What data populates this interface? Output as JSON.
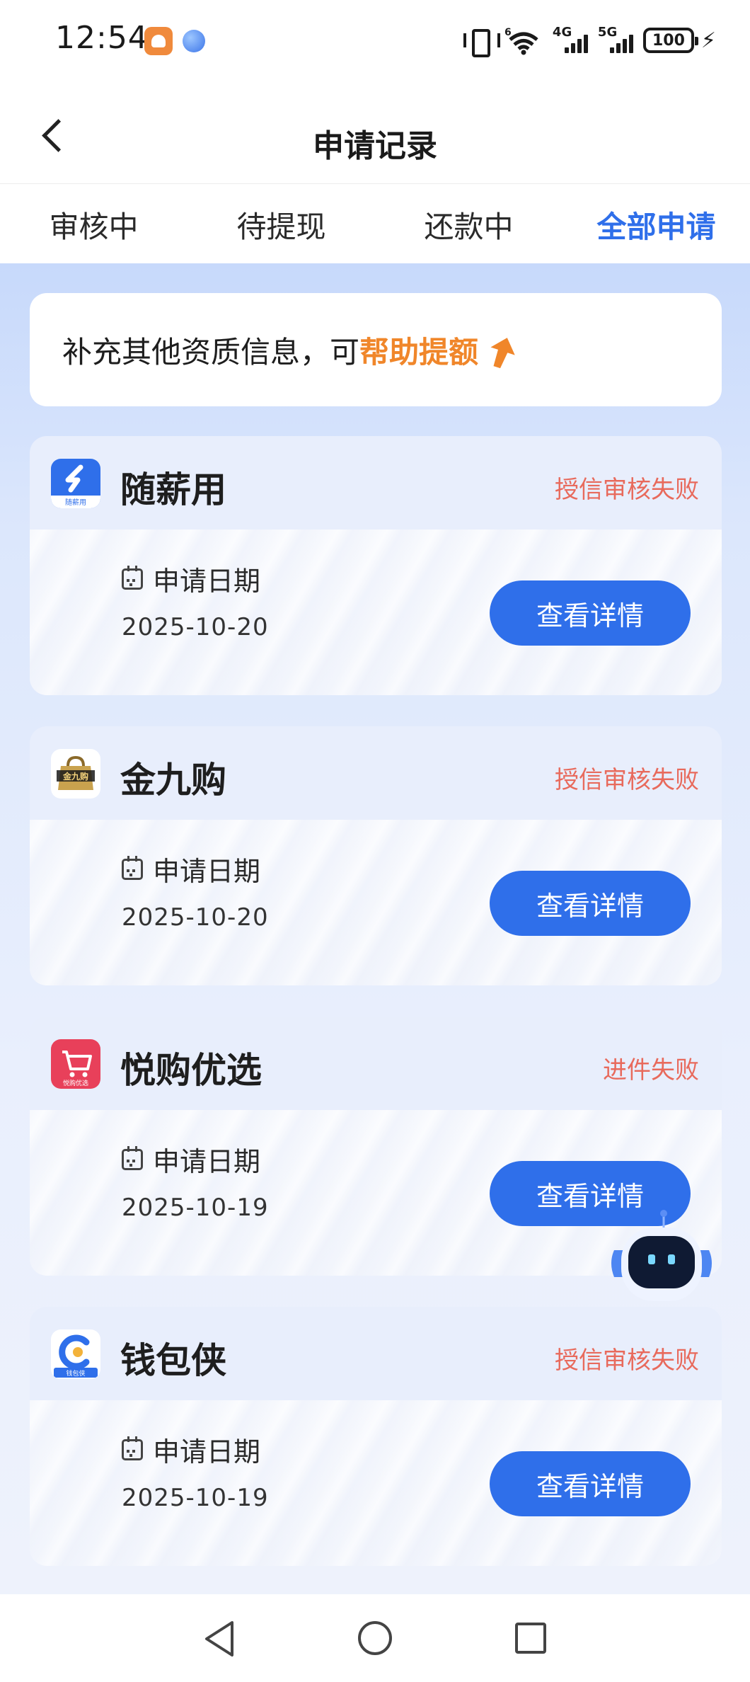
{
  "status_bar": {
    "time": "12:54",
    "network_4g": "4G",
    "network_5g": "5G",
    "wifi_label": "6",
    "battery": "100",
    "charging": "⚡"
  },
  "header": {
    "title": "申请记录"
  },
  "tabs": [
    {
      "label": "审核中",
      "active": false
    },
    {
      "label": "待提现",
      "active": false
    },
    {
      "label": "还款中",
      "active": false
    },
    {
      "label": "全部申请",
      "active": true
    }
  ],
  "promo": {
    "text": "补充其他资质信息，可",
    "highlight": "帮助提额"
  },
  "records": [
    {
      "name": "随薪用",
      "status": "授信审核失败",
      "date_label": "申请日期",
      "date": "2025-10-20",
      "button": "查看详情",
      "logo_text": "随薪用"
    },
    {
      "name": "金九购",
      "status": "授信审核失败",
      "date_label": "申请日期",
      "date": "2025-10-20",
      "button": "查看详情",
      "logo_text": "金九购"
    },
    {
      "name": "悦购优选",
      "status": "进件失败",
      "date_label": "申请日期",
      "date": "2025-10-19",
      "button": "查看详情",
      "logo_text": "悦购优选"
    },
    {
      "name": "钱包侠",
      "status": "授信审核失败",
      "date_label": "申请日期",
      "date": "2025-10-19",
      "button": "查看详情",
      "logo_text": "钱包侠"
    }
  ],
  "colors": {
    "accent": "#2f6fea",
    "status_fail": "#e86a5c",
    "promo_highlight": "#f0862a"
  }
}
